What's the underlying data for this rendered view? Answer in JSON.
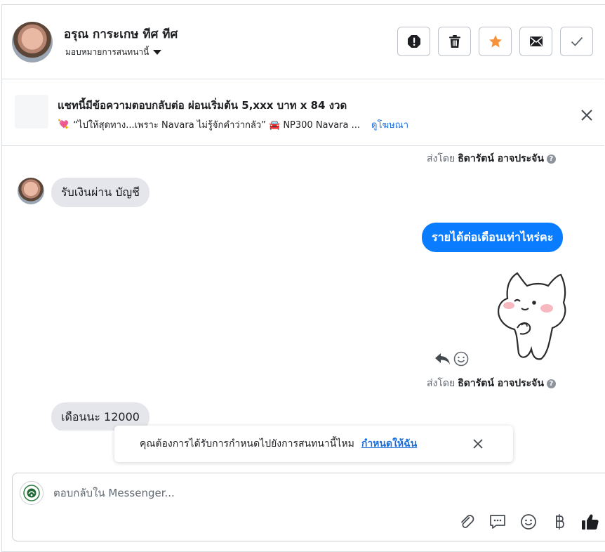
{
  "header": {
    "contact_name": "อรุณ การะเกษ ทีศ ทีศ",
    "assign_label": "มอบหมายการสนทนานี้"
  },
  "ad": {
    "title": "แชทนี้มีข้อความตอบกลับต่อ ผ่อนเริ่มต้น 5,xxx บาท x 84 งวด",
    "subtitle": "“ไปให้สุดทาง...เพราะ Navara ไม่รู้จักคำว่ากลัว” 🚘 NP300 Navara ...",
    "link": "ดูโฆษณา"
  },
  "messages": {
    "sent_by_prefix": "ส่งโดย",
    "sender_name": "ธิดารัตน์ อาจประจัน",
    "incoming_1": "รับเงินผ่าน บัญชี",
    "outgoing_1": "รายได้ต่อเดือนเท่าไหร่คะ",
    "incoming_2": "เดือนนะ 12000"
  },
  "toast": {
    "text": "คุณต้องการได้รับการกำหนดไปยังการสนทนานี้ไหม",
    "link": "กำหนดให้ฉัน"
  },
  "composer": {
    "placeholder": "ตอบกลับใน Messenger..."
  },
  "colors": {
    "accent_blue": "#0a7cff",
    "link_blue": "#1a6ed8",
    "star_orange": "#f7923a",
    "incoming_bubble": "#e4e6eb"
  },
  "icons": {
    "header_actions": [
      "alert-icon",
      "trash-icon",
      "star-icon",
      "envelope-icon",
      "check-icon"
    ],
    "composer_tools": [
      "paperclip-icon",
      "saved-reply-icon",
      "emoji-icon",
      "baht-icon",
      "thumbs-up-icon"
    ]
  }
}
